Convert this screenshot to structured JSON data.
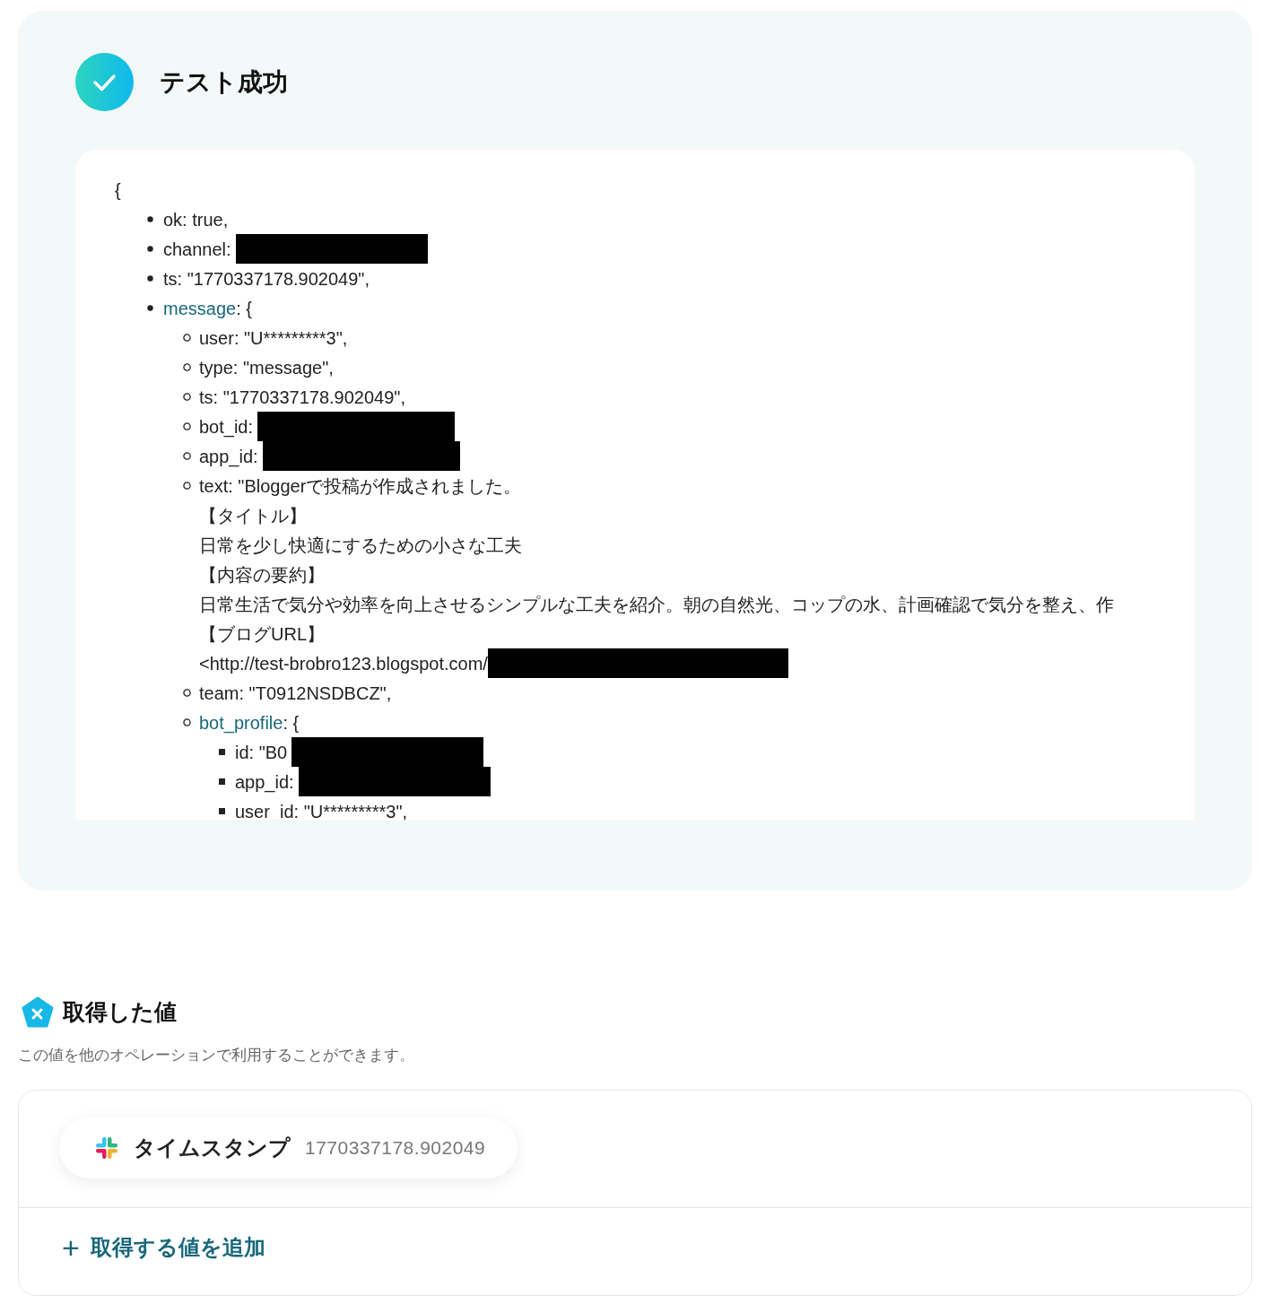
{
  "test_result": {
    "title": "テスト成功",
    "output": {
      "text": "{",
      "children": [
        {
          "kind": "plain",
          "text": "ok: true,"
        },
        {
          "kind": "plain",
          "text": "channel:",
          "redacted": true
        },
        {
          "kind": "plain",
          "text": "ts: \"1770337178.902049\","
        },
        {
          "kind": "object",
          "key": "message",
          "text": ": {",
          "children": [
            {
              "kind": "plain",
              "text": "user: \"U*********3\","
            },
            {
              "kind": "plain",
              "text": "type: \"message\","
            },
            {
              "kind": "plain",
              "text": "ts: \"1770337178.902049\","
            },
            {
              "kind": "plain",
              "text": "bot_id:",
              "redacted": true
            },
            {
              "kind": "plain",
              "text": "app_id:",
              "redacted": true
            },
            {
              "kind": "plain",
              "text": "text: \"Bloggerで投稿が作成されました。",
              "continuation": [
                {
                  "text": "【タイトル】"
                },
                {
                  "text": "日常を少し快適にするための小さな工夫"
                },
                {
                  "text": "【内容の要約】"
                },
                {
                  "text": "日常生活で気分や効率を向上させるシンプルな工夫を紹介。朝の自然光、コップの水、計画確認で気分を整え、作"
                },
                {
                  "text": "【ブログURL】"
                },
                {
                  "text": "<http://test-brobro123.blogspot.com/",
                  "redacted": true
                }
              ]
            },
            {
              "kind": "plain",
              "text": "team: \"T0912NSDBCZ\","
            },
            {
              "kind": "object",
              "key": "bot_profile",
              "text": ": {",
              "children": [
                {
                  "kind": "plain",
                  "text": "id: \"B0",
                  "redacted": true
                },
                {
                  "kind": "plain",
                  "text": "app_id:",
                  "redacted": true
                },
                {
                  "kind": "plain",
                  "text": "user_id: \"U*********3\","
                }
              ]
            }
          ]
        }
      ]
    }
  },
  "obtained_values": {
    "title": "取得した値",
    "description": "この値を他のオペレーションで利用することができます。",
    "values": [
      {
        "label": "タイムスタンプ",
        "value": "1770337178.902049"
      }
    ],
    "add_button": {
      "icon": "+",
      "label": "取得する値を追加"
    }
  }
}
